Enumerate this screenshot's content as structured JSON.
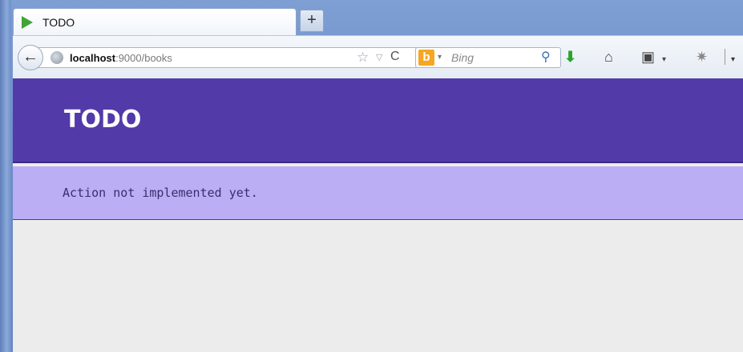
{
  "browser": {
    "tab": {
      "title": "TODO"
    },
    "new_tab_label": "+",
    "back_label": "←",
    "url": {
      "host": "localhost",
      "rest": ":9000/books"
    },
    "url_star": "☆",
    "url_dropdown": "▽",
    "reload_label": "C",
    "search": {
      "engine_logo": "b",
      "engine_dropdown": "▾",
      "placeholder": "Bing",
      "search_icon": "⚲"
    },
    "toolbar": {
      "download_icon": "⬇",
      "home_icon": "⌂",
      "bookmarks_icon": "▣",
      "bookmarks_dropdown": "▾",
      "addon_icon": "✷",
      "menu_dropdown": "▾"
    }
  },
  "page": {
    "header_title": "TODO",
    "flash_message": "Action not implemented yet."
  },
  "colors": {
    "header_bg": "#523aa9",
    "flash_bg": "#bbaef4",
    "content_bg": "#ececec",
    "favicon": "#3fa535"
  }
}
